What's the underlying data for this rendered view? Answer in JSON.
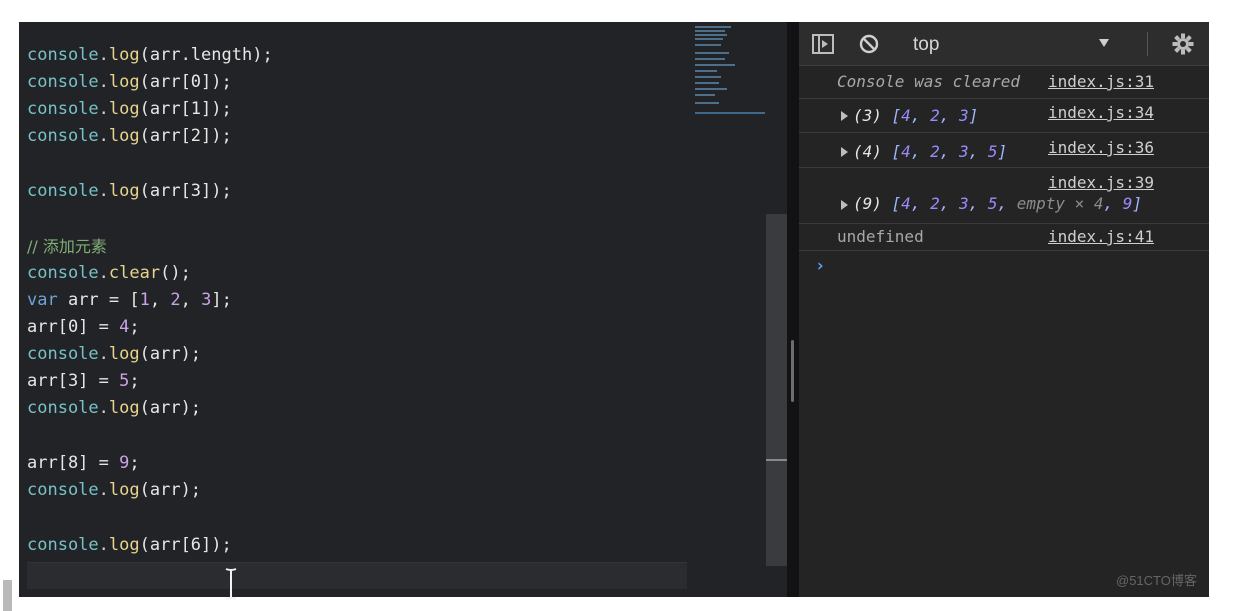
{
  "editor": {
    "comment": "// 添加元素",
    "lines": [
      {
        "obj": "console",
        "dot": ".",
        "fn": "log",
        "args": "(arr.length);"
      },
      {
        "obj": "console",
        "dot": ".",
        "fn": "log",
        "args": "(arr[0]);"
      },
      {
        "obj": "console",
        "dot": ".",
        "fn": "log",
        "args": "(arr[1]);"
      },
      {
        "obj": "console",
        "dot": ".",
        "fn": "log",
        "args": "(arr[2]);"
      },
      {
        "obj": "console",
        "dot": ".",
        "fn": "log",
        "args": "(arr[3]);"
      },
      {
        "obj": "console",
        "dot": ".",
        "fn": "clear",
        "args": "();"
      },
      {
        "kw": "var",
        "rest": " arr = [",
        "n1": "1",
        "c1": ", ",
        "n2": "2",
        "c2": ", ",
        "n3": "3",
        "end": "];"
      },
      {
        "lhs": "arr[0] = ",
        "num": "4",
        "end": ";"
      },
      {
        "obj": "console",
        "dot": ".",
        "fn": "log",
        "args": "(arr);"
      },
      {
        "lhs": "arr[3] = ",
        "num": "5",
        "end": ";"
      },
      {
        "obj": "console",
        "dot": ".",
        "fn": "log",
        "args": "(arr);"
      },
      {
        "lhs": "arr[8] = ",
        "num": "9",
        "end": ";"
      },
      {
        "obj": "console",
        "dot": ".",
        "fn": "log",
        "args": "(arr);"
      },
      {
        "obj": "console",
        "dot": ".",
        "fn": "log",
        "args": "(arr[6]);"
      }
    ]
  },
  "console": {
    "context": "top",
    "icons": {
      "sidebar": "sidebar-toggle-icon",
      "clear": "clear-console-icon",
      "settings": "gear-icon",
      "dropdown": "chevron-down-icon"
    },
    "cleared": {
      "text": "Console was cleared",
      "source": "index.js:31"
    },
    "log1": {
      "count": "(3)",
      "open": " [",
      "v1": "4",
      "c1": ", ",
      "v2": "2",
      "c2": ", ",
      "v3": "3",
      "close": "]",
      "source": "index.js:34"
    },
    "log2": {
      "count": "(4)",
      "open": " [",
      "v1": "4",
      "c1": ", ",
      "v2": "2",
      "c2": ", ",
      "v3": "3",
      "c3": ", ",
      "v4": "5",
      "close": "]",
      "source": "index.js:36"
    },
    "log3": {
      "count": "(9)",
      "open": " [",
      "v1": "4",
      "c1": ", ",
      "v2": "2",
      "c2": ", ",
      "v3": "3",
      "c3": ", ",
      "v4": "5",
      "c4": ", ",
      "empty": "empty × 4",
      "c5": ", ",
      "v5": "9",
      "close": "]",
      "source": "index.js:39"
    },
    "log4": {
      "text": "undefined",
      "source": "index.js:41"
    },
    "prompt": "›"
  },
  "watermark": "@51CTO博客",
  "colors": {
    "editor_bg": "#222326",
    "console_bg": "#242424",
    "link_blue": "#5aa2ff"
  }
}
